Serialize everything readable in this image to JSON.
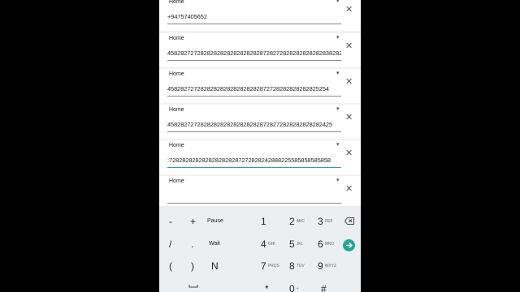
{
  "contacts": [
    {
      "type": "Home",
      "number": "+94757405652"
    },
    {
      "type": "Home",
      "number": "45828272728282828282828282828728272828282828282838282"
    },
    {
      "type": "Home",
      "number": "4582827272828282828282828282872728282828282825254"
    },
    {
      "type": "Home",
      "number": "45828272728282828282828282828728272828282828282425"
    },
    {
      "type": "Home",
      "number": ":7282828282828282828287272828242888225585858585858"
    },
    {
      "type": "Home",
      "number": ""
    }
  ],
  "keypad": {
    "row1": {
      "minus": "-",
      "plus": "+",
      "pause": "Pause",
      "d1": "1",
      "d2": "2",
      "d2_letters": "ABC",
      "d3": "3",
      "d3_letters": "DEF"
    },
    "row2": {
      "slash": "/",
      "dot": ".",
      "wait": "Wait",
      "d4": "4",
      "d4_letters": "GHI",
      "d5": "5",
      "d5_letters": "JKL",
      "d6": "6",
      "d6_letters": "MNO"
    },
    "row3": {
      "lparen": "(",
      "rparen": ")",
      "n": "N",
      "d7": "7",
      "d7_letters": "PRQS",
      "d8": "8",
      "d8_letters": "TUV",
      "d9": "9",
      "d9_letters": "WXYZ"
    },
    "row4": {
      "star": "*",
      "d0": "0",
      "d0_letters": "+",
      "hash": "#"
    }
  },
  "icons": {
    "clear": "close-icon",
    "caret": "dropdown-caret-icon",
    "backspace": "backspace-icon",
    "go": "arrow-right-circle-icon",
    "space": "space-bar-icon"
  },
  "colors": {
    "accent": "#26a69a",
    "keypad_bg": "#eceff1"
  }
}
